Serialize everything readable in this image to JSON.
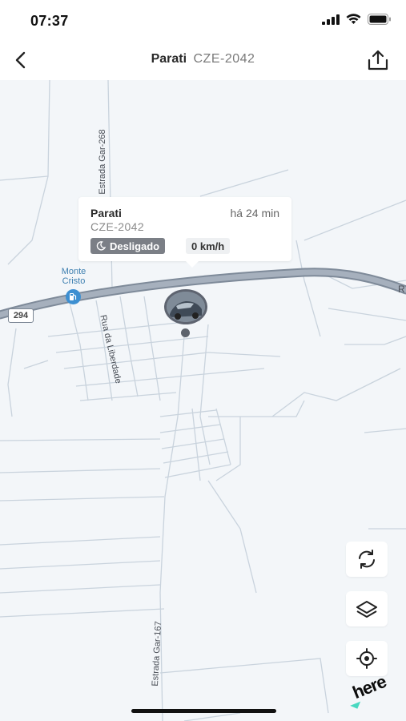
{
  "status_bar": {
    "time": "07:37"
  },
  "nav": {
    "vehicle_name": "Parati",
    "vehicle_plate": "CZE-2042"
  },
  "popup": {
    "name": "Parati",
    "plate": "CZE-2042",
    "last_update": "há 24 min",
    "status_label": "Desligado",
    "speed": "0 km/h"
  },
  "map": {
    "road_labels": {
      "estrada_top": "Estrada Gar-268",
      "rua": "Rua da Liberdade",
      "estrada_bottom": "Estrada Gar-167",
      "highway_edge": "R"
    },
    "shield_number": "294",
    "poi_name": "Monte Cristo",
    "attribution": "here"
  },
  "colors": {
    "map_background": "#f3f6f9",
    "road_line": "#c9d3dd",
    "highway_fill": "#9aa5b3",
    "chip_off": "#7b7f86",
    "poi_blue": "#3d8fd1"
  },
  "icons": {
    "back": "chevron-left-icon",
    "share": "share-icon",
    "refresh": "refresh-icon",
    "layers": "layers-icon",
    "locate": "locate-icon",
    "fuel": "fuel-pump-icon",
    "status": "moon-icon"
  }
}
